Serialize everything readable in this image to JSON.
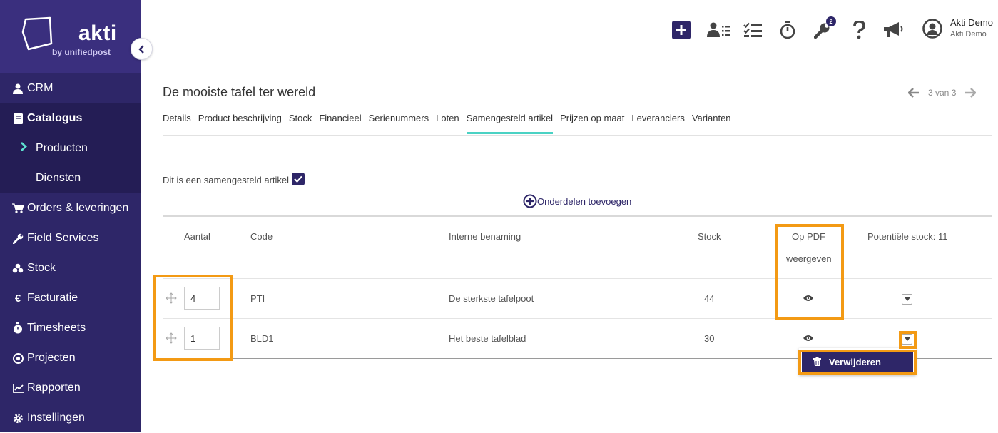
{
  "app": {
    "logo_text": "akti",
    "logo_sub": "by unifiedpost",
    "user_name": "Akti Demo",
    "user_sub": "Akti Demo",
    "notification_count": "2",
    "brand_color": "#2e2668",
    "accent_color": "#4ad2c4",
    "highlight_color": "#f39a14"
  },
  "sidebar": {
    "items": [
      {
        "label": "CRM",
        "icon": "user-icon"
      },
      {
        "label": "Catalogus",
        "icon": "book-icon"
      },
      {
        "label": "Producten",
        "icon": "chevron-right-icon"
      },
      {
        "label": "Diensten",
        "icon": ""
      },
      {
        "label": "Orders & leveringen",
        "icon": "cart-icon"
      },
      {
        "label": "Field Services",
        "icon": "wrench-icon"
      },
      {
        "label": "Stock",
        "icon": "boxes-icon"
      },
      {
        "label": "Facturatie",
        "icon": "euro-icon"
      },
      {
        "label": "Timesheets",
        "icon": "stopwatch-icon"
      },
      {
        "label": "Projecten",
        "icon": "target-icon"
      },
      {
        "label": "Rapporten",
        "icon": "chart-icon"
      },
      {
        "label": "Instellingen",
        "icon": "gear-icon"
      }
    ]
  },
  "page": {
    "title": "De mooiste tafel ter wereld",
    "pager": "3 van 3"
  },
  "tabs": [
    "Details",
    "Product beschrijving",
    "Stock",
    "Financieel",
    "Serienummers",
    "Loten",
    "Samengesteld artikel",
    "Prijzen op maat",
    "Leveranciers",
    "Varianten"
  ],
  "composite": {
    "label": "Dit is een samengesteld artikel",
    "checked": true,
    "add_parts_label": "Onderdelen toevoegen"
  },
  "table": {
    "headers": {
      "aantal": "Aantal",
      "code": "Code",
      "interne_benaming": "Interne benaming",
      "stock": "Stock",
      "op_pdf_line1": "Op PDF",
      "op_pdf_line2": "weergeven",
      "potentiele_stock": "Potentiële stock: 11"
    },
    "rows": [
      {
        "aantal": "4",
        "code": "PTI",
        "benaming": "De sterkste tafelpoot",
        "stock": "44"
      },
      {
        "aantal": "1",
        "code": "BLD1",
        "benaming": "Het beste tafelblad",
        "stock": "30"
      }
    ]
  },
  "row_menu": {
    "delete_label": "Verwijderen"
  }
}
